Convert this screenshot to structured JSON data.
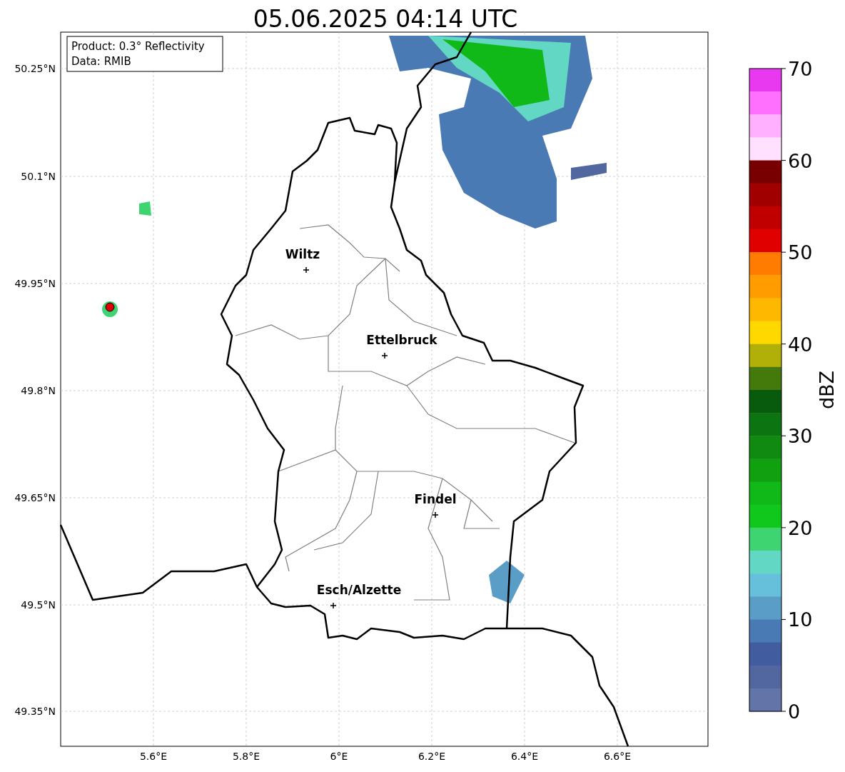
{
  "title": "05.06.2025 04:14 UTC",
  "info": [
    "Product: 0.3° Reflectivity",
    "Data: RMIB"
  ],
  "cities": [
    "Wiltz",
    "Ettelbruck",
    "Findel",
    "Esch/Alzette"
  ],
  "x_ticks": [
    "5.6°E",
    "5.8°E",
    "6°E",
    "6.2°E",
    "6.4°E",
    "6.6°E"
  ],
  "y_ticks": [
    "50.25°N",
    "50.1°N",
    "49.95°N",
    "49.8°N",
    "49.65°N",
    "49.5°N",
    "49.35°N"
  ],
  "colorbar": {
    "label": "dBZ",
    "ticks": [
      "70",
      "60",
      "50",
      "40",
      "30",
      "20",
      "10",
      "0"
    ],
    "segments": [
      {
        "color": "#e838f0"
      },
      {
        "color": "#ff70ff"
      },
      {
        "color": "#ffb0ff"
      },
      {
        "color": "#ffe0ff"
      },
      {
        "color": "#780000"
      },
      {
        "color": "#a00000"
      },
      {
        "color": "#c00000"
      },
      {
        "color": "#e00000"
      },
      {
        "color": "#ff7c00"
      },
      {
        "color": "#ff9c00"
      },
      {
        "color": "#ffb800"
      },
      {
        "color": "#ffd800"
      },
      {
        "color": "#b0b008"
      },
      {
        "color": "#447a0c"
      },
      {
        "color": "#085a0c"
      },
      {
        "color": "#0c7410"
      },
      {
        "color": "#108a10"
      },
      {
        "color": "#10a010"
      },
      {
        "color": "#10b818"
      },
      {
        "color": "#10c81c"
      },
      {
        "color": "#3ed472"
      },
      {
        "color": "#62d8c4"
      },
      {
        "color": "#66c0dc"
      },
      {
        "color": "#5a9ec8"
      },
      {
        "color": "#4a7ab4"
      },
      {
        "color": "#425ca0"
      },
      {
        "color": "#5266a0"
      },
      {
        "color": "#6374a8"
      }
    ]
  }
}
